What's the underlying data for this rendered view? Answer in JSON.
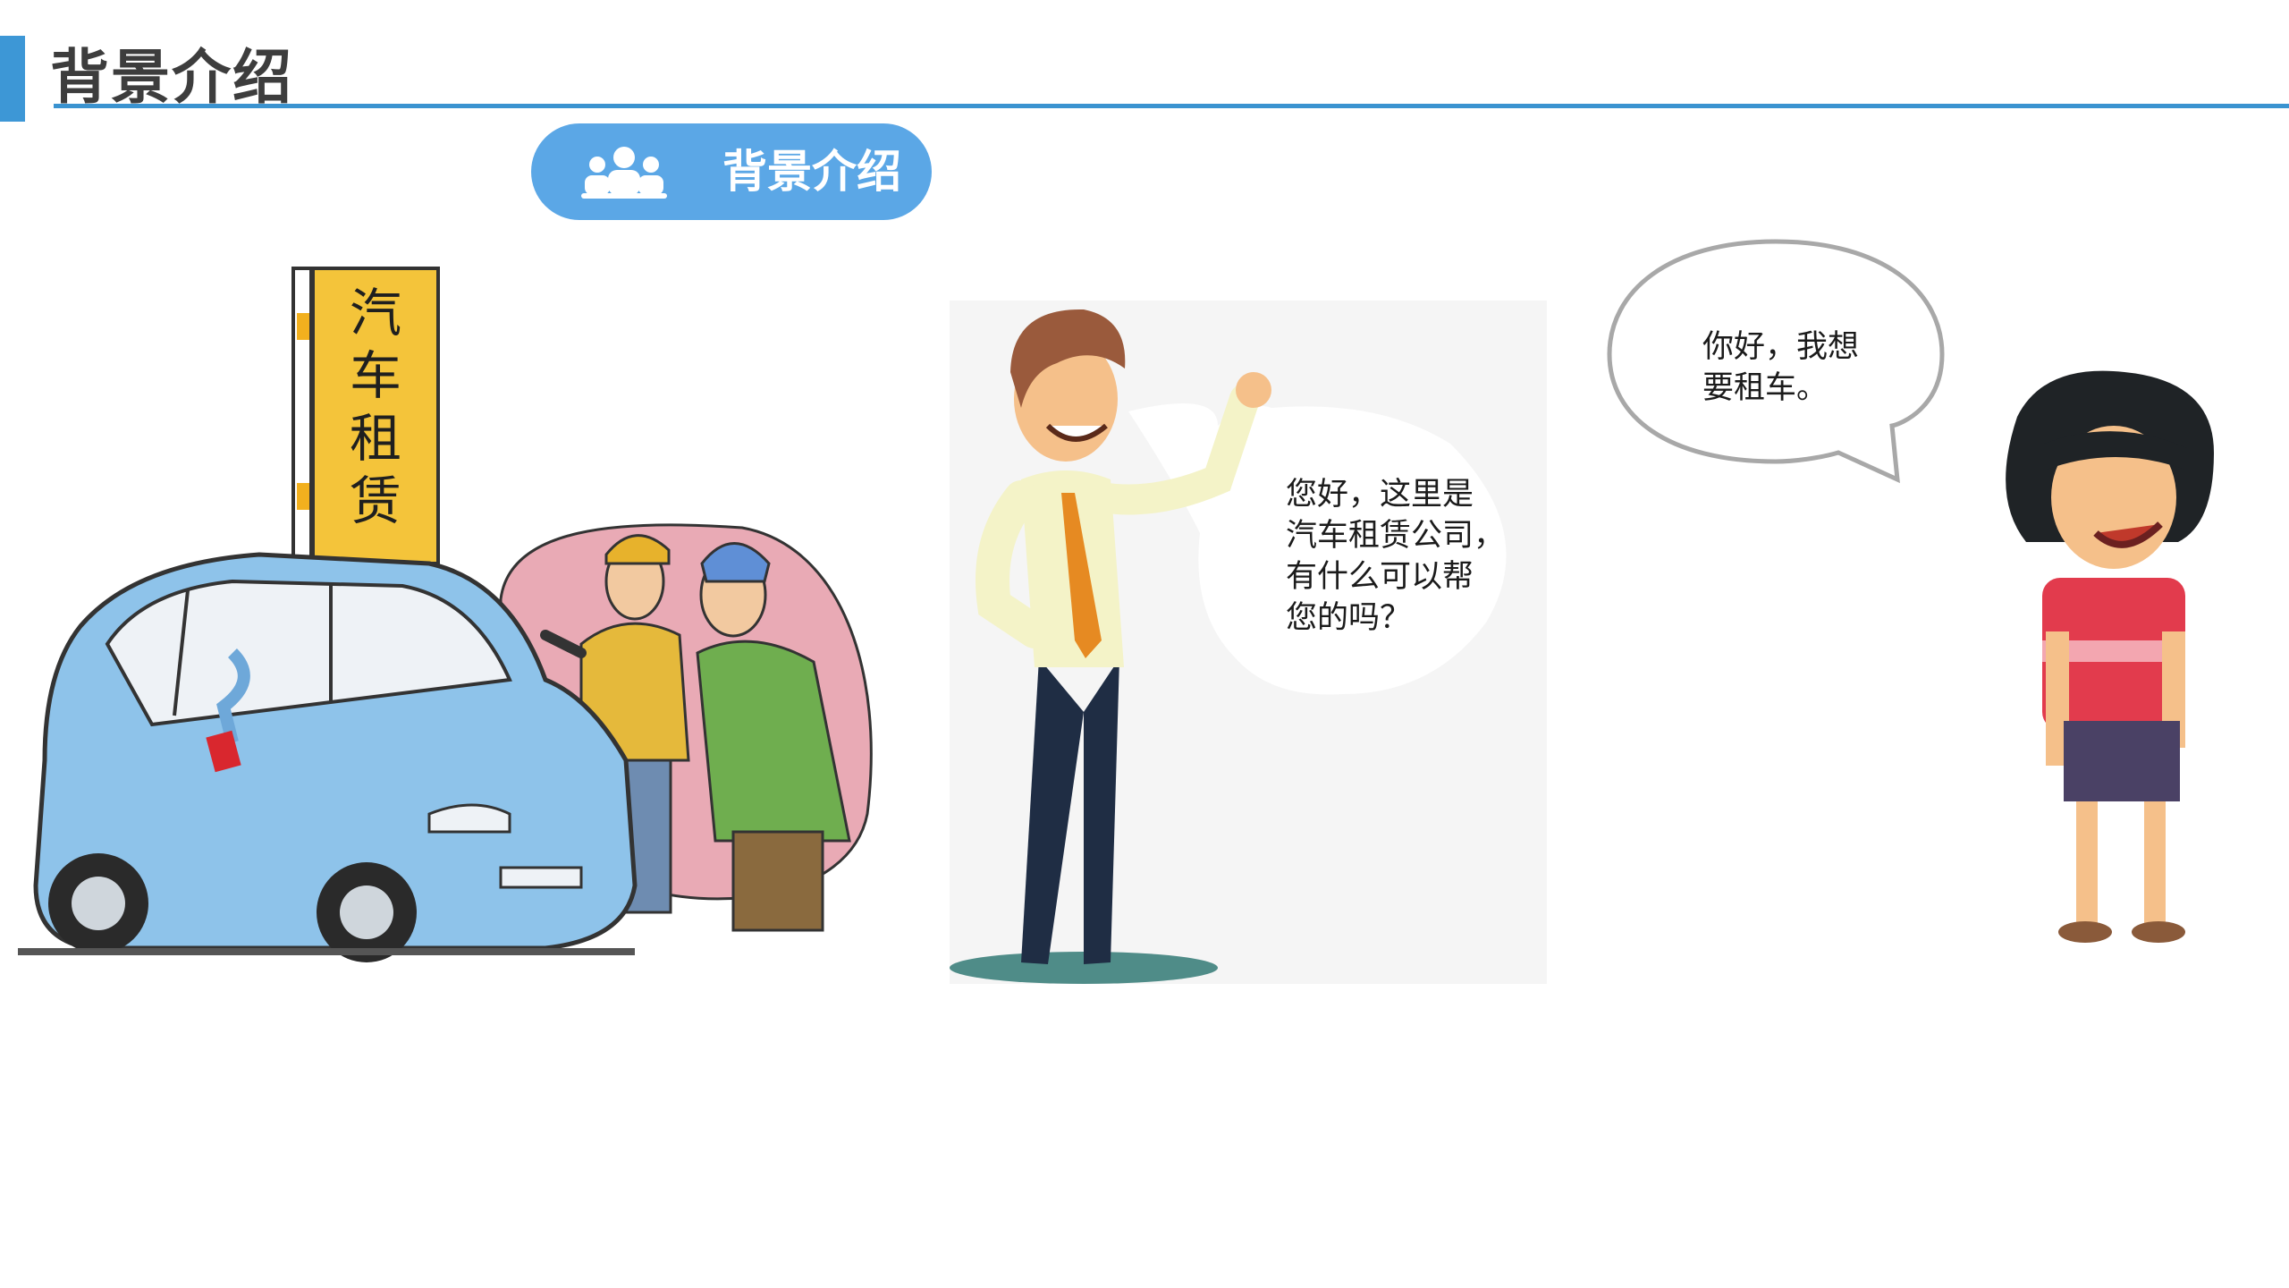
{
  "header": {
    "title": "背景介绍"
  },
  "section_badge": {
    "label": "背景介绍",
    "icon": "group-people-icon"
  },
  "car_scene": {
    "sign_text": "汽车租赁"
  },
  "agent_scene": {
    "speech": "您好，这里是\n汽车租赁公司，\n有什么可以帮\n您的吗？"
  },
  "customer_scene": {
    "speech": "你好，我想\n要租车。"
  },
  "colors": {
    "accent": "#3d97d6",
    "badge": "#5ba7e6",
    "sign": "#f4c43a",
    "car": "#8ec3ea"
  }
}
